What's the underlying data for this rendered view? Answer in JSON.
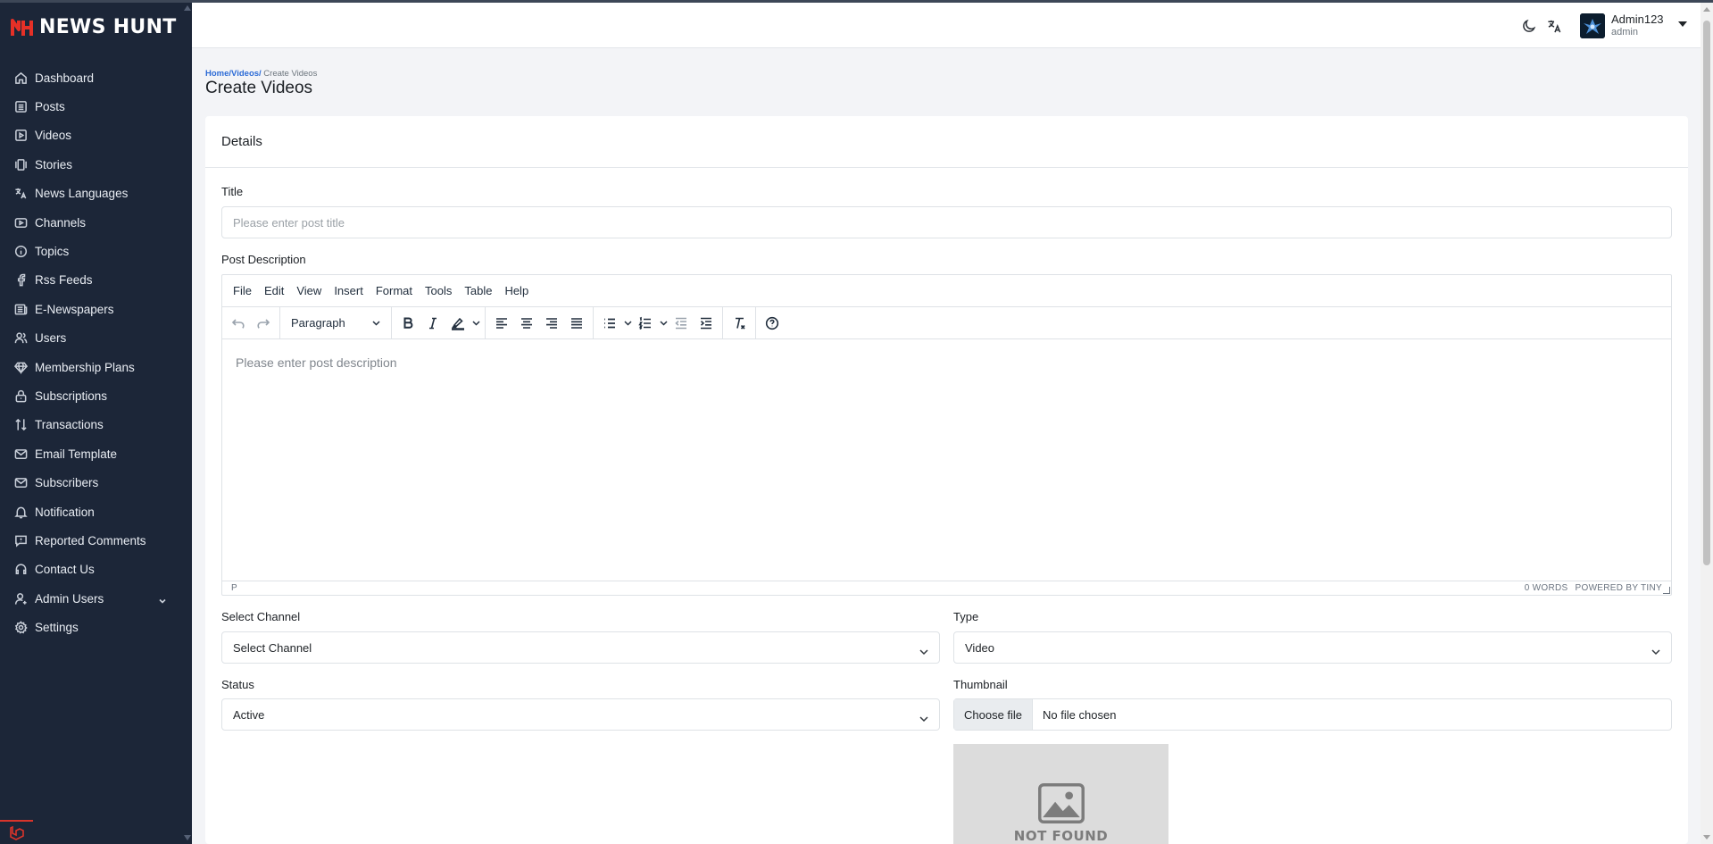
{
  "brand": {
    "name": "NEWS HUNT",
    "accent": "#e63027"
  },
  "sidebar": {
    "items": [
      {
        "label": "Dashboard",
        "icon": "home-icon"
      },
      {
        "label": "Posts",
        "icon": "list-icon"
      },
      {
        "label": "Videos",
        "icon": "play-icon"
      },
      {
        "label": "Stories",
        "icon": "stories-icon"
      },
      {
        "label": "News Languages",
        "icon": "translate-icon"
      },
      {
        "label": "Channels",
        "icon": "channel-icon"
      },
      {
        "label": "Topics",
        "icon": "info-icon"
      },
      {
        "label": "Rss Feeds",
        "icon": "rss-icon"
      },
      {
        "label": "E-Newspapers",
        "icon": "newspaper-icon"
      },
      {
        "label": "Users",
        "icon": "users-icon"
      },
      {
        "label": "Membership Plans",
        "icon": "diamond-icon"
      },
      {
        "label": "Subscriptions",
        "icon": "lock-icon"
      },
      {
        "label": "Transactions",
        "icon": "transfer-icon"
      },
      {
        "label": "Email Template",
        "icon": "mail-icon"
      },
      {
        "label": "Subscribers",
        "icon": "mail-icon"
      },
      {
        "label": "Notification",
        "icon": "bell-icon"
      },
      {
        "label": "Reported Comments",
        "icon": "comment-icon"
      },
      {
        "label": "Contact Us",
        "icon": "headset-icon"
      },
      {
        "label": "Admin Users",
        "icon": "admin-icon"
      },
      {
        "label": "Settings",
        "icon": "gear-icon"
      }
    ]
  },
  "header": {
    "user_name": "Admin123",
    "user_role": "admin"
  },
  "breadcrumb": {
    "home": "Home/",
    "videos": "Videos/",
    "current": " Create Videos"
  },
  "page_title": "Create Videos",
  "card": {
    "title": "Details",
    "title_field": {
      "label": "Title",
      "placeholder": "Please enter post title"
    },
    "description": {
      "label": "Post Description",
      "menu": [
        "File",
        "Edit",
        "View",
        "Insert",
        "Format",
        "Tools",
        "Table",
        "Help"
      ],
      "block_format": "Paragraph",
      "placeholder": "Please enter post description",
      "status_path": "P",
      "word_count": "0 WORDS",
      "powered_by": "POWERED BY TINY"
    },
    "channel": {
      "label": "Select Channel",
      "value": "Select Channel"
    },
    "type": {
      "label": "Type",
      "value": "Video"
    },
    "status": {
      "label": "Status",
      "value": "Active"
    },
    "thumbnail": {
      "label": "Thumbnail",
      "button": "Choose file",
      "file_name": "No file chosen",
      "preview_text": "NOT FOUND"
    }
  }
}
